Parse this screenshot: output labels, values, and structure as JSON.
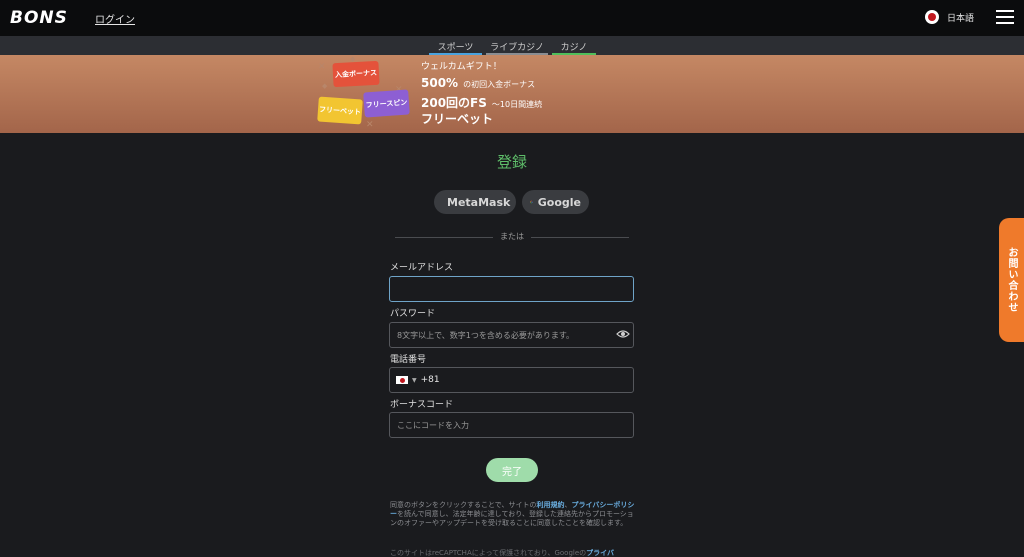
{
  "header": {
    "logo": "BONS",
    "login_label": "ログイン",
    "language_label": "日本語"
  },
  "nav": {
    "tabs": [
      {
        "label": "スポーツ",
        "underline_color": "#4aa3df"
      },
      {
        "label": "ライブカジノ",
        "underline_color": "#8a8d92"
      },
      {
        "label": "カジノ",
        "underline_color": "#4fbf5b"
      }
    ]
  },
  "banner": {
    "ticket_deposit_bonus": "入金ボーナス",
    "ticket_free_bet": "フリーベット",
    "ticket_free_spin": "フリースピン",
    "welcome_gift": "ウェルカムギフト！",
    "bonus_percent": "500%",
    "bonus_percent_desc": "の初回入金ボーナス",
    "fs_count": "200回のFS",
    "fs_desc": "〜10日間連続",
    "free_bet": "フリーベット"
  },
  "form": {
    "title": "登録",
    "metamask_label": "MetaMask",
    "google_label": "Google",
    "or_text": "または",
    "email_label": "メールアドレス",
    "email_value": "",
    "password_label": "パスワード",
    "password_placeholder": "8文字以上で、数字1つを含める必要があります。",
    "phone_label": "電話番号",
    "phone_country_code": "+81",
    "bonus_code_label": "ボーナスコード",
    "bonus_code_placeholder": "ここにコードを入力",
    "submit_label": "完了"
  },
  "legal": {
    "text_before": "同意のボタンをクリックすることで、サイトの",
    "terms_link": "利用規約",
    "separator": "、",
    "privacy_link": "プライバシーポリシー",
    "text_after": "を読んで同意し、法定年齢に達しており、登録した連絡先からプロモーションのオファーやアップデートを受け取ることに同意したことを確認します。",
    "recaptcha_text": "このサイトはreCAPTCHAによって保護されており、Googleの",
    "recaptcha_link": "プライバ"
  },
  "contact_tab_label": "お問い合わせ",
  "colors": {
    "accent_green": "#5fbf6a",
    "submit_green": "#9fdcaa",
    "contact_orange": "#ef7a2b",
    "link_blue": "#6aaee0"
  }
}
